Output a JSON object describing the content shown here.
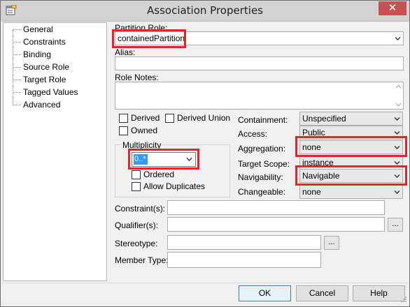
{
  "window": {
    "title": "Association Properties",
    "close_glyph": "✕",
    "title_icon": "properties-icon"
  },
  "tree": {
    "items": [
      {
        "label": "General"
      },
      {
        "label": "Constraints"
      },
      {
        "label": "Binding"
      },
      {
        "label": "Source Role"
      },
      {
        "label": "Target Role",
        "selected": true
      },
      {
        "label": "Tagged Values"
      },
      {
        "label": "Advanced"
      }
    ]
  },
  "form": {
    "partition_role_label": "Partition Role:",
    "partition_role_value": "containedPartition",
    "alias_label": "Alias:",
    "alias_value": "",
    "role_notes_label": "Role Notes:",
    "role_notes_value": "",
    "derived_label": "Derived",
    "derived_union_label": "Derived Union",
    "owned_label": "Owned",
    "multiplicity_label": "Multiplicity",
    "multiplicity_value": "0..*",
    "ordered_label": "Ordered",
    "allow_duplicates_label": "Allow Duplicates",
    "containment_label": "Containment:",
    "containment_value": "Unspecified",
    "access_label": "Access:",
    "access_value": "Public",
    "aggregation_label": "Aggregation:",
    "aggregation_value": "none",
    "target_scope_label": "Target Scope:",
    "target_scope_value": "instance",
    "navigability_label": "Navigability:",
    "navigability_value": "Navigable",
    "changeable_label": "Changeable:",
    "changeable_value": "none",
    "constraints_label": "Constraint(s):",
    "constraints_value": "",
    "qualifiers_label": "Qualifier(s):",
    "qualifiers_value": "",
    "qualifiers_btn": "...",
    "stereotype_label": "Stereotype:",
    "stereotype_value": "",
    "stereotype_btn": "...",
    "member_type_label": "Member Type:",
    "member_type_value": ""
  },
  "buttons": {
    "ok": "OK",
    "cancel": "Cancel",
    "help": "Help"
  },
  "colors": {
    "highlight_red": "#e0262a",
    "selection_blue": "#3399ff",
    "close_red": "#c75050"
  }
}
